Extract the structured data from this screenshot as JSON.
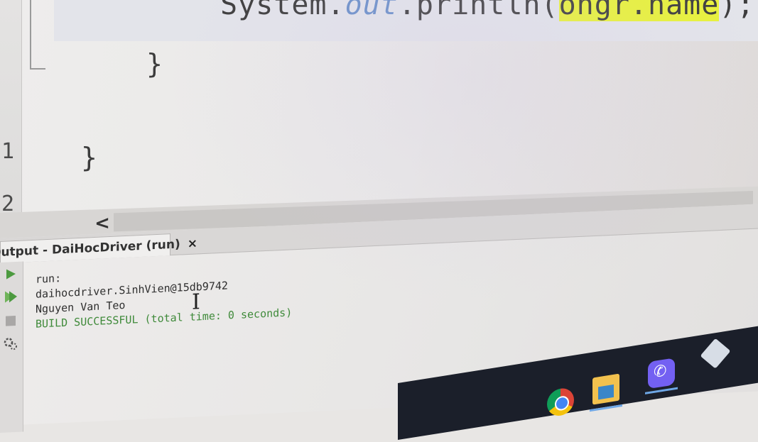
{
  "editor": {
    "gutter_numbers": [
      "1",
      "2"
    ],
    "code_println_prefix": "System.",
    "code_println_out": "out",
    "code_println_mid": ".println(",
    "code_println_arg": "ongr.name",
    "code_println_end": ");",
    "brace_inner": "}",
    "brace_outer": "}"
  },
  "scrollbar": {
    "left_arrow": "<"
  },
  "output": {
    "tab_label": "Output - DaiHocDriver (run)",
    "tab_close": "×",
    "console_lines": {
      "run": "run:",
      "object": "daihocdriver.SinhVien@15db9742",
      "name": "Nguyen Van Teo",
      "build": "BUILD SUCCESSFUL (total time: 0 seconds)"
    },
    "text_cursor": "I"
  },
  "taskbar": {
    "viber_glyph": "✆",
    "accent_color": "#6ea7e6"
  },
  "colors": {
    "success_text": "#3f8a3a",
    "highlight": "#e8f23a",
    "italic_field": "#6a8fc9"
  }
}
